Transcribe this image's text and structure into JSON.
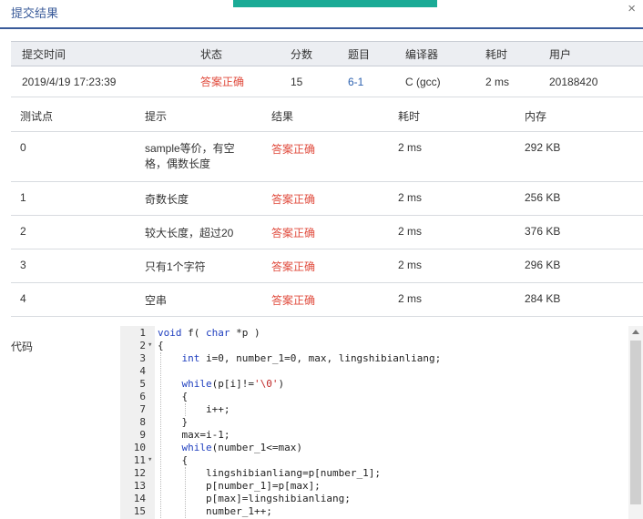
{
  "dialog": {
    "title": "提交结果",
    "close": "×"
  },
  "summary": {
    "headers": [
      "提交时间",
      "状态",
      "分数",
      "题目",
      "编译器",
      "耗时",
      "用户"
    ],
    "row": [
      "2019/4/19 17:23:39",
      "答案正确",
      "15",
      "6-1",
      "C (gcc)",
      "2 ms",
      "20188420"
    ]
  },
  "cases": {
    "headers": [
      "测试点",
      "提示",
      "结果",
      "耗时",
      "内存"
    ],
    "rows": [
      [
        "0",
        "sample等价，有空格，偶数长度",
        "答案正确",
        "2 ms",
        "292 KB"
      ],
      [
        "1",
        "奇数长度",
        "答案正确",
        "2 ms",
        "256 KB"
      ],
      [
        "2",
        "较大长度，超过20",
        "答案正确",
        "2 ms",
        "376 KB"
      ],
      [
        "3",
        "只有1个字符",
        "答案正确",
        "2 ms",
        "296 KB"
      ],
      [
        "4",
        "空串",
        "答案正确",
        "2 ms",
        "284 KB"
      ]
    ]
  },
  "code": {
    "label": "代码",
    "lines": [
      "void f( char *p )",
      "{",
      "    int i=0, number_1=0, max, lingshibianliang;",
      "",
      "    while(p[i]!='\\0')",
      "    {",
      "        i++;",
      "    }",
      "    max=i-1;",
      "    while(number_1<=max)",
      "    {",
      "        lingshibianliang=p[number_1];",
      "        p[number_1]=p[max];",
      "        p[max]=lingshibianliang;",
      "        number_1++;"
    ],
    "fold_lines": [
      2,
      11
    ]
  },
  "colors": {
    "accent": "#1aab96",
    "title": "#3a5b9a",
    "correct": "#e04b3d",
    "link": "#2d62b0"
  }
}
